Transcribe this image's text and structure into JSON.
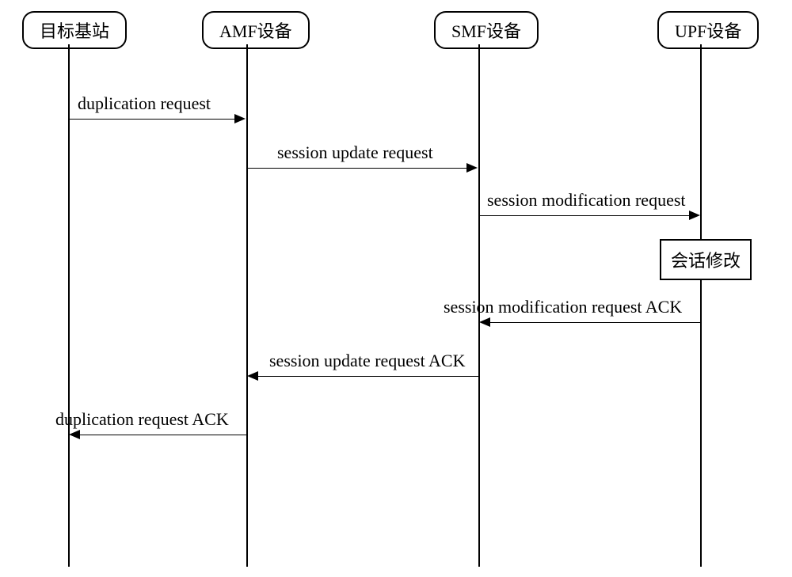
{
  "actors": {
    "target_bs": "目标基站",
    "amf": "AMF设备",
    "smf": "SMF设备",
    "upf": "UPF设备"
  },
  "messages": {
    "dup_req": "duplication request",
    "sess_update_req": "session update request",
    "sess_mod_req": "session modification request",
    "sess_mod_ack": "session modification request ACK",
    "sess_update_ack": "session update request ACK",
    "dup_ack": "duplication request ACK"
  },
  "activation": {
    "session_modify": "会话修改"
  }
}
